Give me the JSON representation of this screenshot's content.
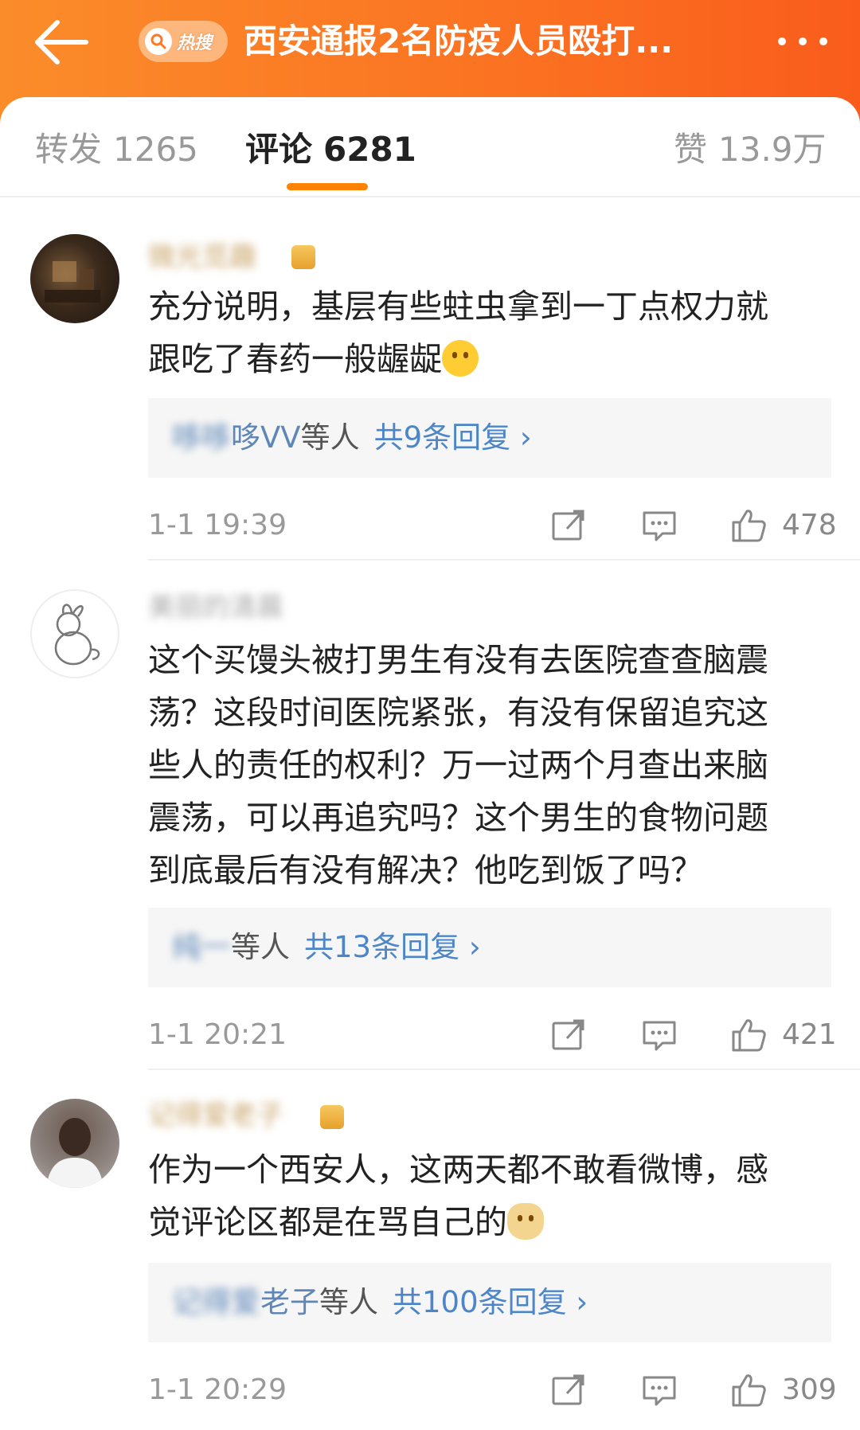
{
  "header": {
    "back_icon": "arrow-left-icon",
    "hot_badge": "热搜",
    "title": "西安通报2名防疫人员殴打...",
    "more_icon": "more-dots-icon",
    "gradient": [
      "#fb8c2a",
      "#fa5c1c"
    ]
  },
  "tabs": [
    {
      "label": "转发",
      "count": "1265"
    },
    {
      "label": "评论",
      "count": "6281"
    },
    {
      "label": "赞",
      "count": "13.9万"
    }
  ],
  "active_tab": "评论",
  "comments": [
    {
      "username": "微光觅趣",
      "text_lines": [
        "充分说明，基层有些蛀虫拿到一丁点权力就",
        "跟吃了春药一般龌龊"
      ],
      "emoji": "drooling-emoji",
      "reply_who_blurred": "哆哆",
      "reply_who_clear": "哆VV",
      "reply_etc": "等人",
      "reply_count": "共9条回复 ›",
      "time": "1-1 19:39",
      "likes": "478"
    },
    {
      "username": "美丽的清晨",
      "text_lines": [
        "这个买馒头被打男生有没有去医院查查脑震",
        "荡？这段时间医院紧张，有没有保留追究这",
        "些人的责任的权利？万一过两个月查出来脑",
        "震荡，可以再追究吗？这个男生的食物问题",
        "到底最后有没有解决？他吃到饭了吗？"
      ],
      "emoji": "",
      "reply_who_blurred": "纯一",
      "reply_who_clear": "",
      "reply_etc": "等人",
      "reply_count": "共13条回复 ›",
      "time": "1-1 20:21",
      "likes": "421"
    },
    {
      "username": "记得爱老子",
      "text_lines": [
        "作为一个西安人，这两天都不敢看微博，感",
        "觉评论区都是在骂自己的"
      ],
      "emoji": "doge-emoji",
      "reply_who_blurred": "记得爱",
      "reply_who_clear": "老子",
      "reply_etc": "等人",
      "reply_count": "共100条回复 ›",
      "time": "1-1 20:29",
      "likes": "309"
    }
  ],
  "colors": {
    "accent": "#ff8200",
    "link": "#4d86c8",
    "meta": "#999999"
  },
  "action_icons": [
    "share-icon",
    "comment-icon",
    "like-thumb-icon"
  ]
}
